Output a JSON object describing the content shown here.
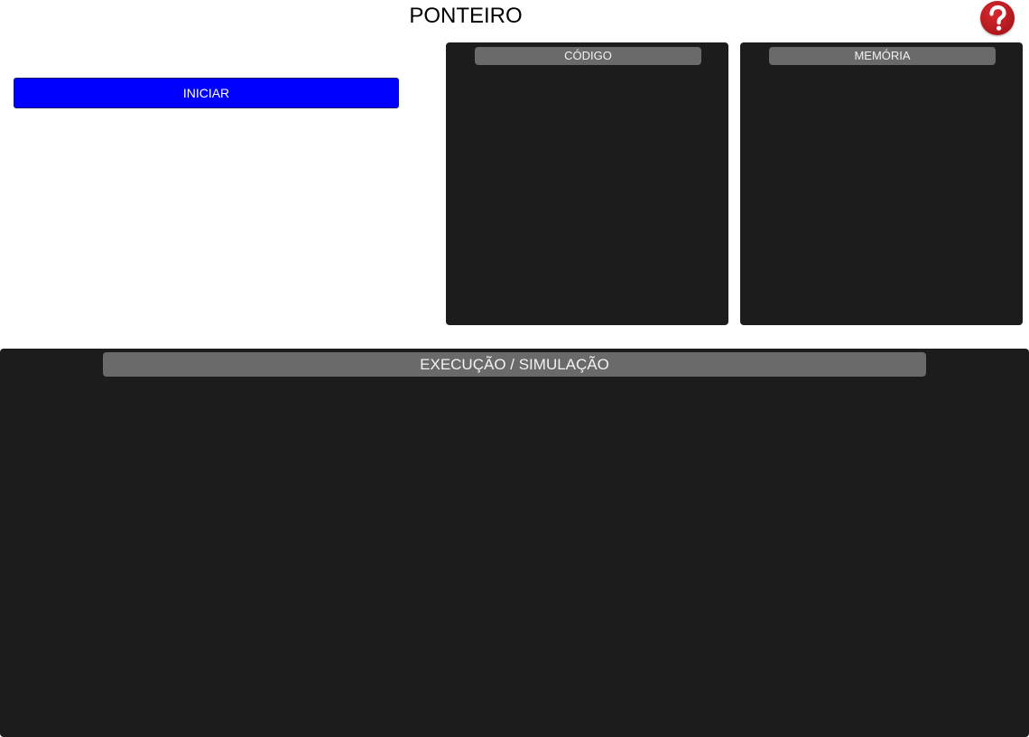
{
  "app": {
    "title": "PONTEIRO"
  },
  "toolbar": {
    "start_label": "INICIAR",
    "help_icon": "question-mark-icon"
  },
  "panels": {
    "code": {
      "header": "CÓDIGO"
    },
    "memory": {
      "header": "MEMÓRIA"
    },
    "execution": {
      "header": "EXECUÇÃO / SIMULAÇÃO"
    }
  },
  "colors": {
    "start_button": "#0000ff",
    "panel_background": "#1c1c1c",
    "panel_header": "#6a6a6a",
    "help_button": "#b51a20"
  }
}
